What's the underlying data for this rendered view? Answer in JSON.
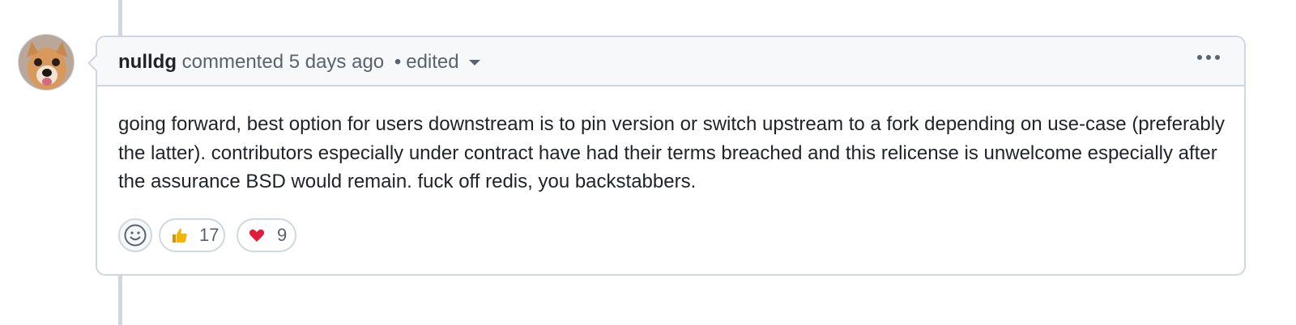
{
  "comment": {
    "author": "nulldg",
    "action": "commented",
    "timestamp": "5 days ago",
    "separator": "•",
    "edited_label": "edited",
    "body": "going forward, best option for users downstream is to pin version or switch upstream to a fork depending on use-case (preferably the latter). contributors especially under contract have had their terms breached and this relicense is unwelcome especially after the assurance BSD would remain. fuck off redis, you backstabbers."
  },
  "reactions": {
    "add_icon": "smiley-icon",
    "items": [
      {
        "icon": "thumbs-up-icon",
        "count": "17"
      },
      {
        "icon": "heart-icon",
        "count": "9"
      }
    ]
  },
  "menu_icon": "kebab-horizontal-icon",
  "avatar_icon": "user-avatar",
  "colors": {
    "border": "#d0d7de",
    "header_bg": "#f6f8fa",
    "muted_text": "#59636e",
    "text": "#1f2328",
    "heart": "#e01e3c",
    "thumb": "#f5b400"
  }
}
